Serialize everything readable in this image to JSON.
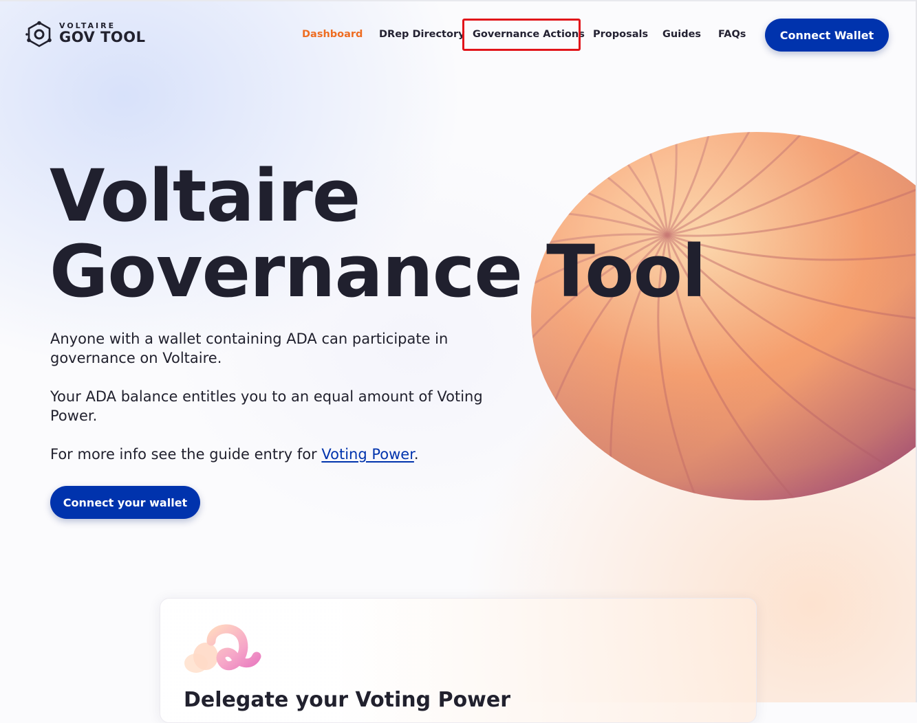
{
  "header": {
    "logo": {
      "top_text": "VOLTAIRE",
      "main_text": "GOV TOOL"
    },
    "nav": [
      {
        "label": "Dashboard",
        "active": true
      },
      {
        "label": "DRep Directory",
        "active": false
      },
      {
        "label": "Governance Actions",
        "active": false
      },
      {
        "label": "Proposals",
        "active": false
      },
      {
        "label": "Guides",
        "active": false
      },
      {
        "label": "FAQs",
        "active": false
      }
    ],
    "connect_wallet_label": "Connect Wallet"
  },
  "hero": {
    "title_line1": "Voltaire",
    "title_line2": "Governance Tool",
    "paragraph1": "Anyone with a wallet containing ADA can participate in governance on Voltaire.",
    "paragraph2": "Your ADA balance entitles you to an equal amount of Voting Power.",
    "paragraph3_prefix": "For more info see the guide entry for ",
    "paragraph3_link": "Voting Power",
    "paragraph3_suffix": ".",
    "cta_label": "Connect your wallet"
  },
  "card": {
    "title": "Delegate your Voting Power"
  },
  "colors": {
    "primary": "#0033ad",
    "active_nav": "#ee6d22",
    "highlight_box": "#e1141a",
    "text": "#21212e"
  }
}
